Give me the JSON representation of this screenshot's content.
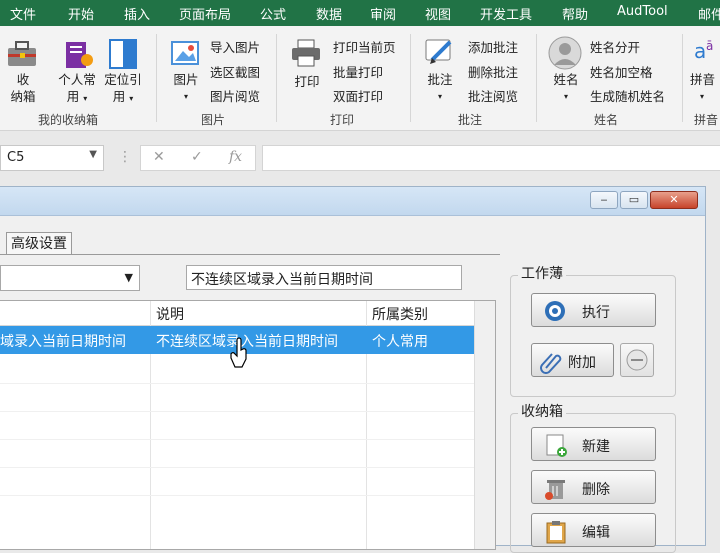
{
  "menubar": {
    "items": [
      "文件",
      "开始",
      "插入",
      "页面布局",
      "公式",
      "数据",
      "审阅",
      "视图",
      "开发工具",
      "帮助",
      "AudTool",
      "邮件"
    ],
    "bg_color": "#217346"
  },
  "ribbon": {
    "my_box": {
      "btn1_line1": "收",
      "btn1_line2": "纳箱",
      "btn2_line1": "个人常",
      "btn2_line2": "用",
      "btn3_line1": "定位引",
      "btn3_line2": "用",
      "label": "我的收纳箱"
    },
    "pictures": {
      "big_label": "图片",
      "items": [
        "导入图片",
        "选区截图",
        "图片阅览"
      ],
      "label": "图片"
    },
    "print": {
      "big_label": "打印",
      "items": [
        "打印当前页",
        "批量打印",
        "双面打印"
      ],
      "label": "打印"
    },
    "comments": {
      "big_label": "批注",
      "items": [
        "添加批注",
        "删除批注",
        "批注阅览"
      ],
      "label": "批注"
    },
    "names": {
      "big_label": "姓名",
      "items": [
        "姓名分开",
        "姓名加空格",
        "生成随机姓名"
      ],
      "label": "姓名"
    },
    "pinyin": {
      "big_label": "拼音",
      "label": "拼音"
    }
  },
  "formula_bar": {
    "name_box": "C5",
    "cancel_glyph": "✕",
    "enter_glyph": "✓",
    "fx_glyph": "fx"
  },
  "dialog": {
    "tab_label": "高级设置",
    "description_value": "不连续区域录入当前日期时间",
    "columns": [
      "说明",
      "所属类别"
    ],
    "selected_row": {
      "name": "域录入当前日期时间",
      "description": "不连续区域录入当前日期时间",
      "category": "个人常用"
    },
    "workbook_group": {
      "title": "工作薄",
      "execute": "执行",
      "attach": "附加"
    },
    "storage_group": {
      "title": "收纳箱",
      "new": "新建",
      "delete": "删除",
      "edit": "编辑"
    },
    "selection_color": "#3399e6"
  }
}
